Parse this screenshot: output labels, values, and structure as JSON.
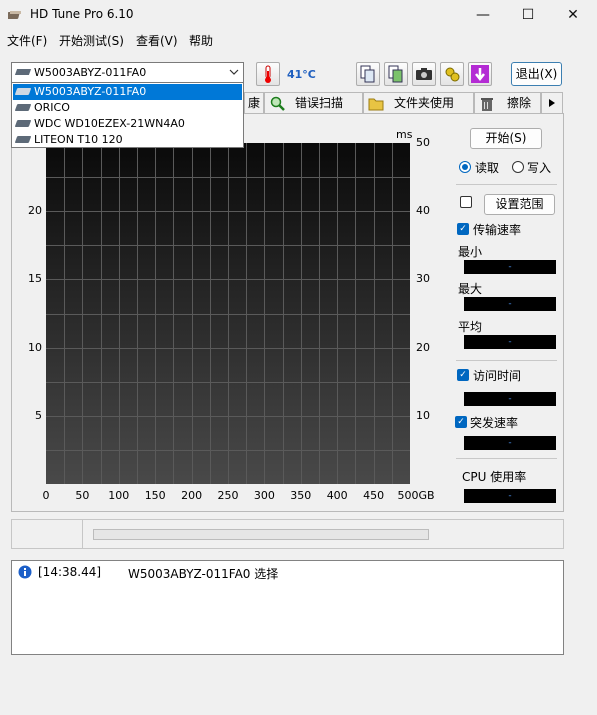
{
  "window": {
    "title": "HD Tune Pro 6.10",
    "controls": {
      "minimize": "—",
      "maximize": "☐",
      "close": "✕"
    }
  },
  "menu": [
    "文件(F)",
    "开始测试(S)",
    "查看(V)",
    "帮助"
  ],
  "toolbar": {
    "selected_drive": "W5003ABYZ-011FA0",
    "temperature": "41°C",
    "exit_label": "退出(X)",
    "icons": [
      "copy-text-icon",
      "copy-image-icon",
      "camera-icon",
      "options-icon",
      "save-down-icon"
    ]
  },
  "drive_list": [
    "W5003ABYZ-011FA0",
    "ORICO",
    "WDC WD10EZEX-21WN4A0",
    "LITEON T10 120"
  ],
  "tabs": {
    "partial": "康",
    "error_scan": "错误扫描",
    "folder_usage": "文件夹使用",
    "erase": "擦除"
  },
  "chart_data": {
    "type": "line",
    "x_ticks": [
      "0",
      "50",
      "100",
      "150",
      "200",
      "250",
      "300",
      "350",
      "400",
      "450",
      "500GB"
    ],
    "y_left_ticks": [
      "5",
      "10",
      "15",
      "20"
    ],
    "y_right_unit": "ms",
    "y_right_ticks": [
      "50",
      "40",
      "30",
      "20",
      "10"
    ],
    "series": []
  },
  "side": {
    "start_label": "开始(S)",
    "read_label": "读取",
    "write_label": "写入",
    "range_label": "设置范围",
    "transfer_label": "传输速率",
    "min_label": "最小",
    "max_label": "最大",
    "avg_label": "平均",
    "access_label": "访问时间",
    "burst_label": "突发速率",
    "cpu_label": "CPU 使用率",
    "placeholder_value": "-"
  },
  "log": {
    "time": "[14:38.44]",
    "message": "W5003ABYZ-011FA0 选择"
  }
}
